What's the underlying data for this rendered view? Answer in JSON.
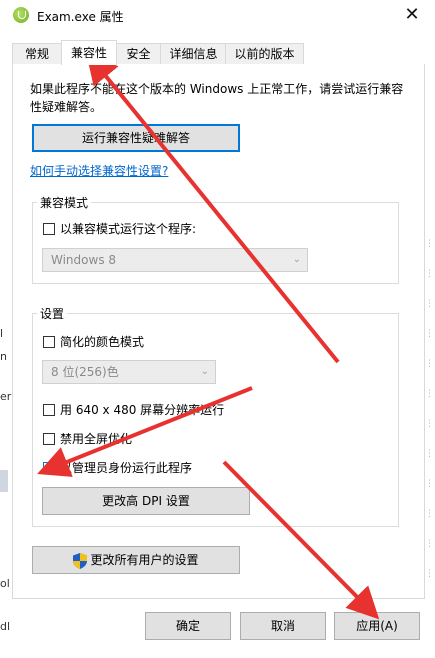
{
  "window": {
    "title": "Exam.exe 属性",
    "close_glyph": "✕"
  },
  "tabs": [
    {
      "label": "常规"
    },
    {
      "label": "兼容性"
    },
    {
      "label": "安全"
    },
    {
      "label": "详细信息"
    },
    {
      "label": "以前的版本"
    }
  ],
  "active_tab": "兼容性",
  "description": "如果此程序不能在这个版本的 Windows 上正常工作，请尝试运行兼容性疑难解答。",
  "troubleshooter_button": "运行兼容性疑难解答",
  "manual_link": "如何手动选择兼容性设置?",
  "compat_mode": {
    "group_title": "兼容模式",
    "checkbox_label": "以兼容模式运行这个程序:",
    "checked": false,
    "os_select": "Windows 8"
  },
  "settings": {
    "group_title": "设置",
    "reduced_color": {
      "label": "简化的颜色模式",
      "checked": false
    },
    "color_select": "8 位(256)色",
    "res_640": {
      "label": "用 640 x 480 屏幕分辨率运行",
      "checked": false
    },
    "disable_fullscreen": {
      "label": "禁用全屏优化",
      "checked": false
    },
    "run_as_admin": {
      "label": "以管理员身份运行此程序",
      "checked": true
    },
    "high_dpi_button": "更改高 DPI 设置"
  },
  "all_users_button": "更改所有用户的设置",
  "footer": {
    "ok": "确定",
    "cancel": "取消",
    "apply": "应用(A)"
  },
  "background_fragments": [
    "l",
    "n",
    "er",
    "ol",
    "dl"
  ],
  "colors": {
    "accent": "#0078d7",
    "link": "#0066cc",
    "annotation_arrow": "#e8322f"
  },
  "icons": [
    "app-icon",
    "close-icon",
    "uac-shield-icon",
    "chevron-down-icon"
  ]
}
